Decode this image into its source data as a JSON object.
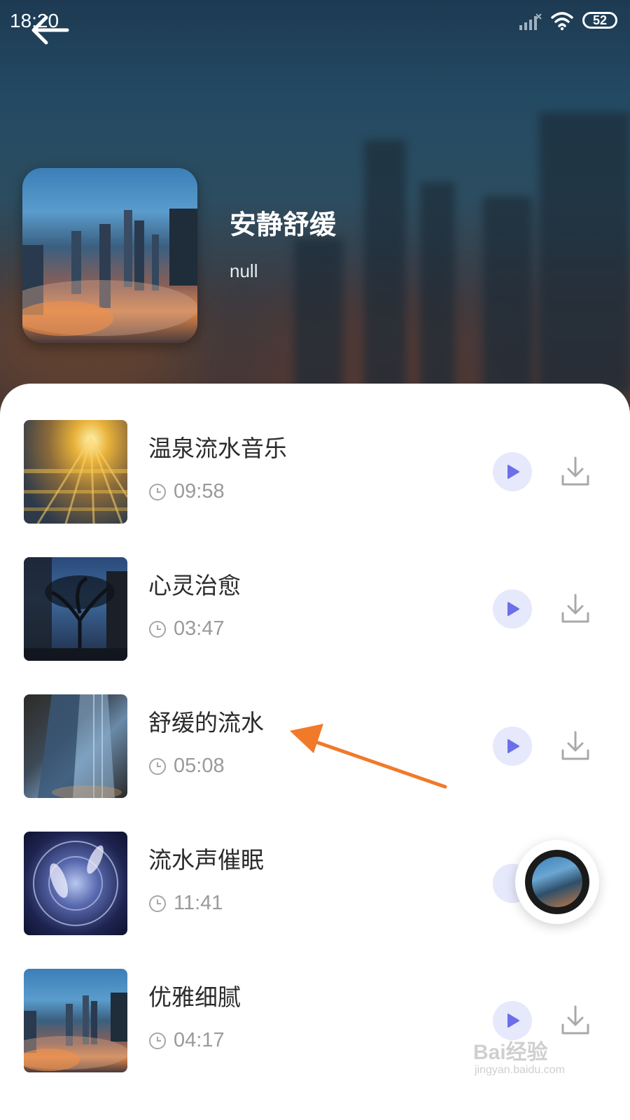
{
  "status_bar": {
    "time": "18:20",
    "battery": "52"
  },
  "album": {
    "title": "安静舒缓",
    "subtitle": "null"
  },
  "songs": [
    {
      "title": "温泉流水音乐",
      "duration": "09:58"
    },
    {
      "title": "心灵治愈",
      "duration": "03:47"
    },
    {
      "title": "舒缓的流水",
      "duration": "05:08"
    },
    {
      "title": "流水声催眠",
      "duration": "11:41"
    },
    {
      "title": "优雅细腻",
      "duration": "04:17"
    }
  ],
  "watermark": {
    "brand": "Bai经验",
    "url": "jingyan.baidu.com"
  },
  "colors": {
    "accent": "#6b6fe8",
    "play_bg": "#e6e8fb",
    "annotation_arrow": "#f07a2a",
    "text_primary": "#2b2b2b",
    "text_secondary": "#9a9a9a"
  },
  "icons": {
    "back": "arrow-left-icon",
    "play": "play-icon",
    "download": "download-icon",
    "clock": "clock-icon",
    "signal": "signal-icon",
    "wifi": "wifi-icon"
  }
}
